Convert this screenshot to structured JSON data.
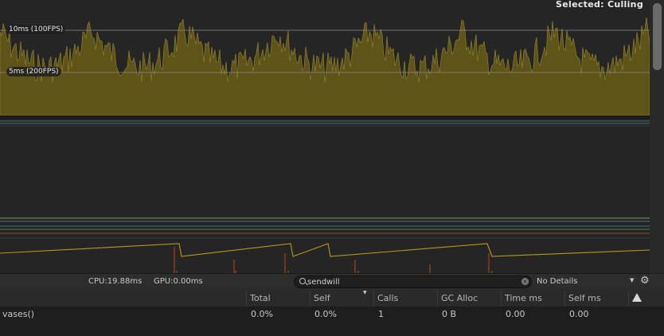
{
  "graph": {
    "label_10ms": "10ms (100FPS)",
    "label_5ms": "5ms (200FPS)",
    "selected": "Selected: Culling",
    "cpu_area_color": "#6b5f1c",
    "cpu_area_fill": "#5e5419",
    "line_color": "#b59a1c",
    "spike_color": "#b84a1c"
  },
  "toolbar": {
    "cpu": "CPU:19.88ms",
    "gpu": "GPU:0.00ms",
    "search_value": "sendwill",
    "details": "No Details"
  },
  "table": {
    "columns": [
      "Total",
      "Self",
      "Calls",
      "GC Alloc",
      "Time ms",
      "Self ms"
    ],
    "row": {
      "name": "vases()",
      "total": "0.0%",
      "self": "0.0%",
      "calls": "1",
      "gc_alloc": "0 B",
      "time_ms": "0.00",
      "self_ms": "0.00"
    }
  }
}
